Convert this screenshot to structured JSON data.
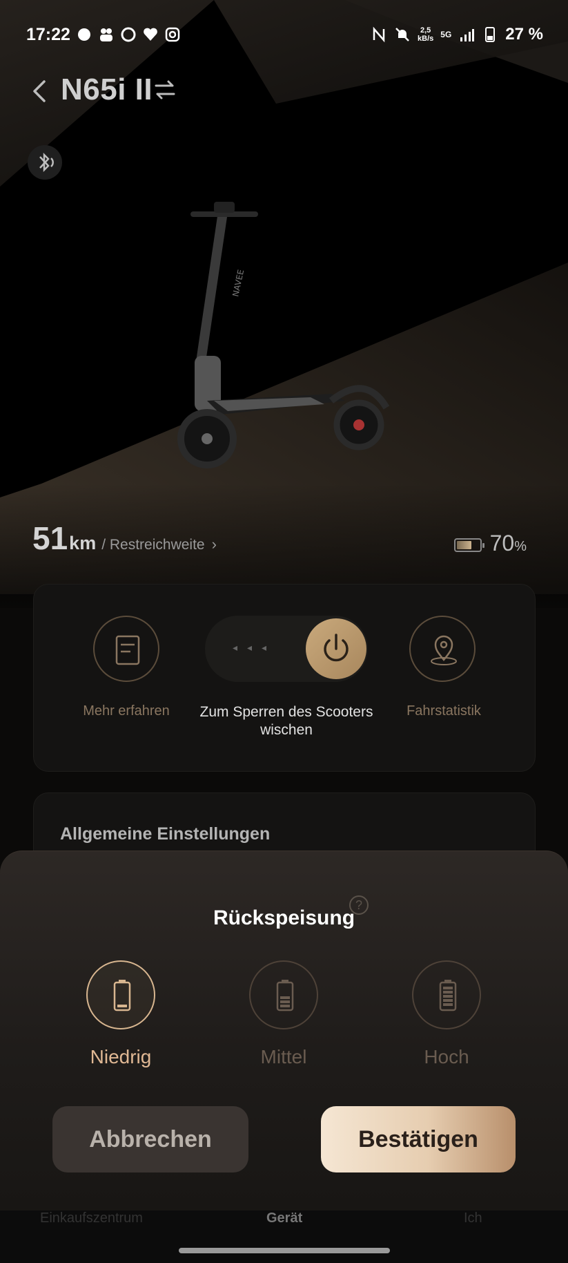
{
  "status_bar": {
    "time": "17:22",
    "data_speed_top": "2,5",
    "data_speed_bottom": "kB/s",
    "network": "5G",
    "battery": "27 %"
  },
  "header": {
    "title": "N65i II"
  },
  "range": {
    "value": "51",
    "unit": "km",
    "label": "/ Restreichweite"
  },
  "battery": {
    "value": "70",
    "unit": "%",
    "level": 0.7
  },
  "controls": {
    "learn_more": "Mehr erfahren",
    "swipe_hint": "Zum Sperren des Scooters wischen",
    "statistics": "Fahrstatistik"
  },
  "settings": {
    "heading": "Allgemeine Einstellungen"
  },
  "nav": {
    "shop": "Einkaufszentrum",
    "device": "Gerät",
    "me": "Ich"
  },
  "sheet": {
    "title": "Rückspeisung",
    "help": "?",
    "options": [
      {
        "label": "Niedrig",
        "selected": true
      },
      {
        "label": "Mittel",
        "selected": false
      },
      {
        "label": "Hoch",
        "selected": false
      }
    ],
    "cancel": "Abbrechen",
    "confirm": "Bestätigen"
  },
  "colors": {
    "accent": "#d8b690",
    "background": "#000000"
  }
}
